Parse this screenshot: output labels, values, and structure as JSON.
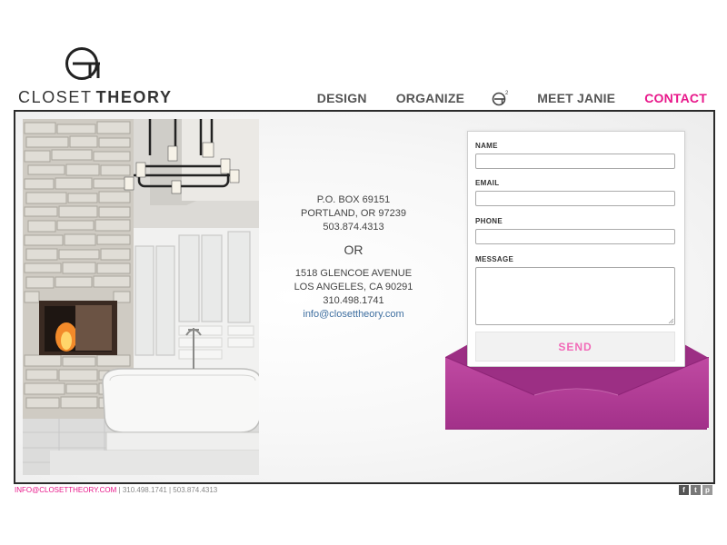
{
  "brand": {
    "name_light": "CLOSET",
    "name_bold": "THEORY"
  },
  "nav": {
    "items": [
      {
        "label": "DESIGN"
      },
      {
        "label": "ORGANIZE"
      },
      {
        "label": "MEET JANIE"
      },
      {
        "label": "CONTACT",
        "active": true
      }
    ],
    "icon": "ct-squared-icon"
  },
  "address": {
    "portland": {
      "line1": "P.O. BOX 69151",
      "line2": "PORTLAND, OR 97239",
      "phone": "503.874.4313"
    },
    "or": "OR",
    "la": {
      "line1": "1518 GLENCOE AVENUE",
      "line2": "LOS ANGELES, CA 90291",
      "phone": "310.498.1741",
      "email": "info@closettheory.com"
    }
  },
  "form": {
    "name_label": "NAME",
    "email_label": "EMAIL",
    "phone_label": "PHONE",
    "message_label": "MESSAGE",
    "send_label": "SEND"
  },
  "footer": {
    "email": "INFO@CLOSETTHEORY.COM",
    "separator": " | ",
    "phone1": "310.498.1741",
    "phone2": "503.874.4313"
  },
  "social": {
    "facebook": "f",
    "twitter": "t",
    "pinterest": "p"
  },
  "colors": {
    "accent": "#e8178a",
    "envelope": "#b43f98",
    "send_text": "#f26ab8",
    "link": "#3f6fa0"
  }
}
